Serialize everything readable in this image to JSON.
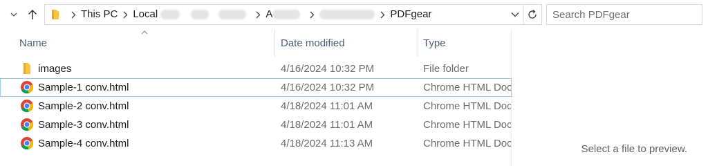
{
  "address": {
    "crumbs": [
      "This PC",
      "Local ",
      "A",
      "PDFgear"
    ]
  },
  "search": {
    "placeholder": "Search PDFgear"
  },
  "columns": {
    "name": "Name",
    "date": "Date modified",
    "type": "Type"
  },
  "files": [
    {
      "name": "images",
      "date": "4/16/2024 10:32 PM",
      "type": "File folder",
      "icon": "folder-icon"
    },
    {
      "name": "Sample-1 conv.html",
      "date": "4/16/2024 10:32 PM",
      "type": "Chrome HTML Document",
      "icon": "chrome-icon"
    },
    {
      "name": "Sample-2 conv.html",
      "date": "4/18/2024 11:01 AM",
      "type": "Chrome HTML Document",
      "icon": "chrome-icon"
    },
    {
      "name": "Sample-3 conv.html",
      "date": "4/18/2024 11:01 AM",
      "type": "Chrome HTML Document",
      "icon": "chrome-icon"
    },
    {
      "name": "Sample-4 conv.html",
      "date": "4/18/2024 11:13 AM",
      "type": "Chrome HTML Document",
      "icon": "chrome-icon"
    }
  ],
  "preview": {
    "message": "Select a file to preview."
  },
  "colors": {
    "header_text": "#4c607a",
    "folder": "#f6c343",
    "focus_outline": "#99c9ef"
  }
}
